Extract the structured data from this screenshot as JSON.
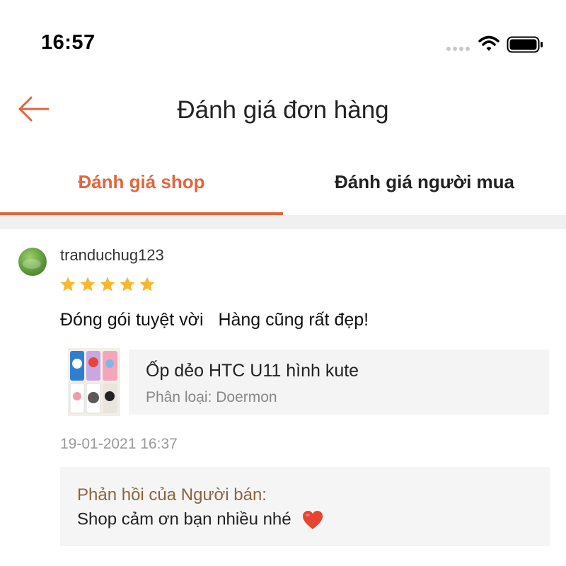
{
  "status_bar": {
    "time": "16:57",
    "icons": [
      "signal-dots-icon",
      "wifi-icon",
      "battery-icon"
    ]
  },
  "header": {
    "back_icon": "back-arrow-icon",
    "title": "Đánh giá đơn hàng"
  },
  "tabs": [
    {
      "label": "Đánh giá shop",
      "active": true
    },
    {
      "label": "Đánh giá người mua",
      "active": false
    }
  ],
  "review": {
    "username": "tranduchug123",
    "rating": 5,
    "comment": "Đóng gói tuyệt vời   Hàng cũng rất đẹp!",
    "product": {
      "name": "Ốp dẻo HTC U11 hình kute",
      "variant": "Phân loại: Doermon"
    },
    "date": "19-01-2021 16:37",
    "seller_reply": {
      "title": "Phản hồi của Người bán:",
      "text": "Shop cảm ơn bạn nhiều nhé"
    }
  },
  "colors": {
    "accent": "#e0663d",
    "star": "#f5b82e",
    "reply_title": "#8a6440",
    "heart": "#e8452f"
  }
}
